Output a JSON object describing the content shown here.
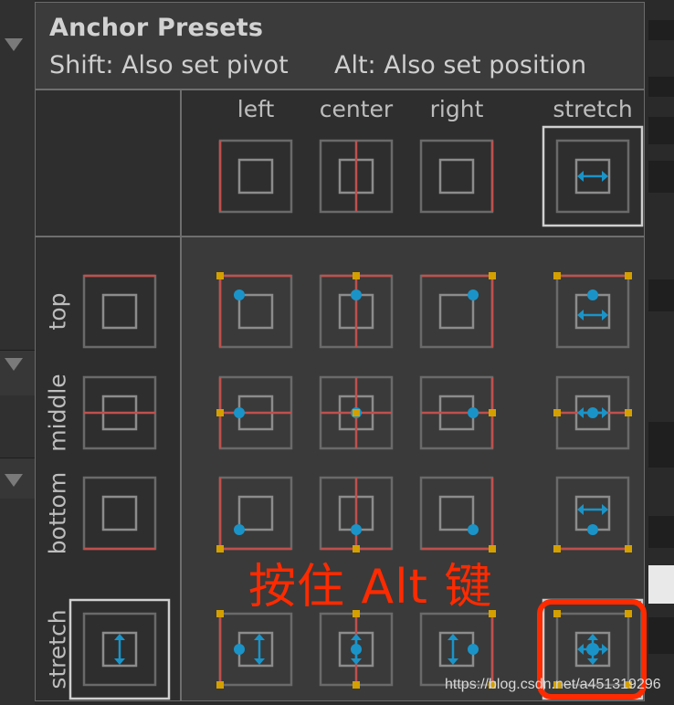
{
  "popup": {
    "title": "Anchor Presets",
    "hint_shift": "Shift: Also set pivot",
    "hint_alt": "Alt: Also set position"
  },
  "columns": [
    {
      "key": "left",
      "label": "left"
    },
    {
      "key": "center",
      "label": "center"
    },
    {
      "key": "right",
      "label": "right"
    },
    {
      "key": "stretch",
      "label": "stretch"
    }
  ],
  "rows": [
    {
      "key": "top",
      "label": "top"
    },
    {
      "key": "middle",
      "label": "middle"
    },
    {
      "key": "bottom",
      "label": "bottom"
    },
    {
      "key": "stretch",
      "label": "stretch"
    }
  ],
  "modifier_held": "Alt",
  "selected_preset": {
    "row": "stretch",
    "col": "stretch"
  },
  "colors": {
    "anchor_line": "#c0504d",
    "anchor_point": "#d4a000",
    "pivot": "#1a94c8",
    "box_outer": "#6a6a6a",
    "box_inner": "#8c8c8c",
    "selection": "#d0d0d0",
    "annotation": "#ff2a00"
  },
  "annotation": {
    "text": "按住 Alt 键"
  },
  "watermark": "https://blog.csdn.net/a451319296"
}
